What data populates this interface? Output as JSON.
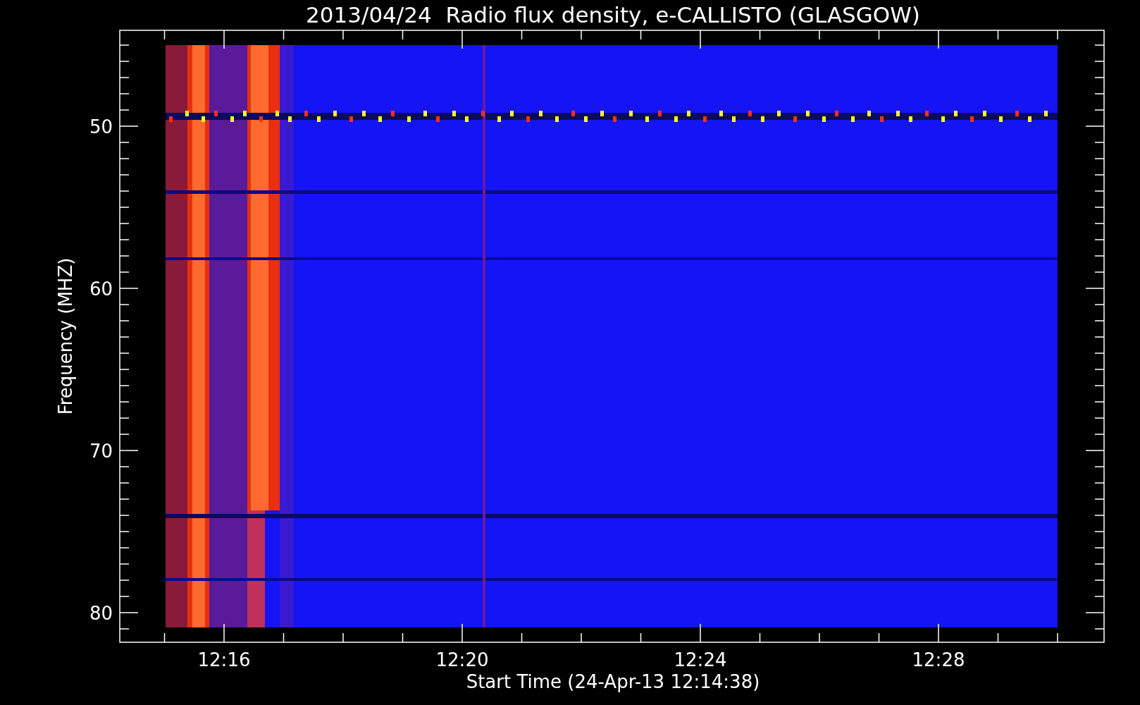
{
  "title": "2013/04/24  Radio flux density, e-CALLISTO (GLASGOW)",
  "y_axis": {
    "label": "Frequency (MHZ)",
    "tick_labels": [
      "50",
      "60",
      "70",
      "80"
    ]
  },
  "x_axis": {
    "label": "Start Time (24-Apr-13 12:14:38)",
    "tick_labels": [
      "12:16",
      "12:20",
      "12:24",
      "12:28"
    ]
  }
}
